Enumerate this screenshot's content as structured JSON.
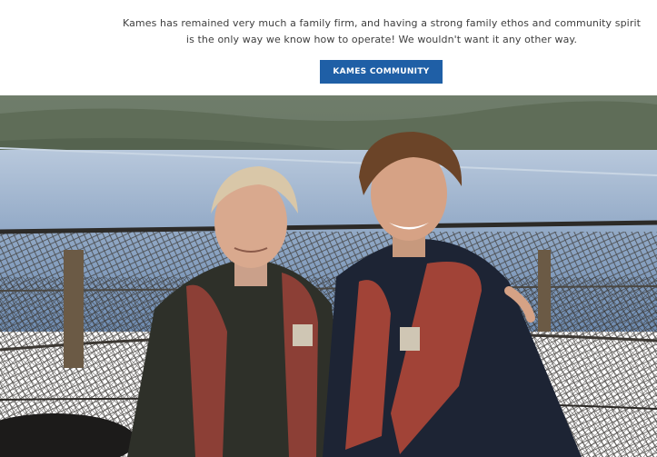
{
  "intro": {
    "line1": "Kames has remained very much a family firm, and having a strong family ethos and community spirit",
    "line2": "is the only way we know how to operate! We wouldn't want it any other way."
  },
  "cta": {
    "label": "KAMES COMMUNITY",
    "color": "#1f5fa6"
  },
  "photo": {
    "alt": "Two men in life vests standing in front of fish farm netting on a loch"
  }
}
